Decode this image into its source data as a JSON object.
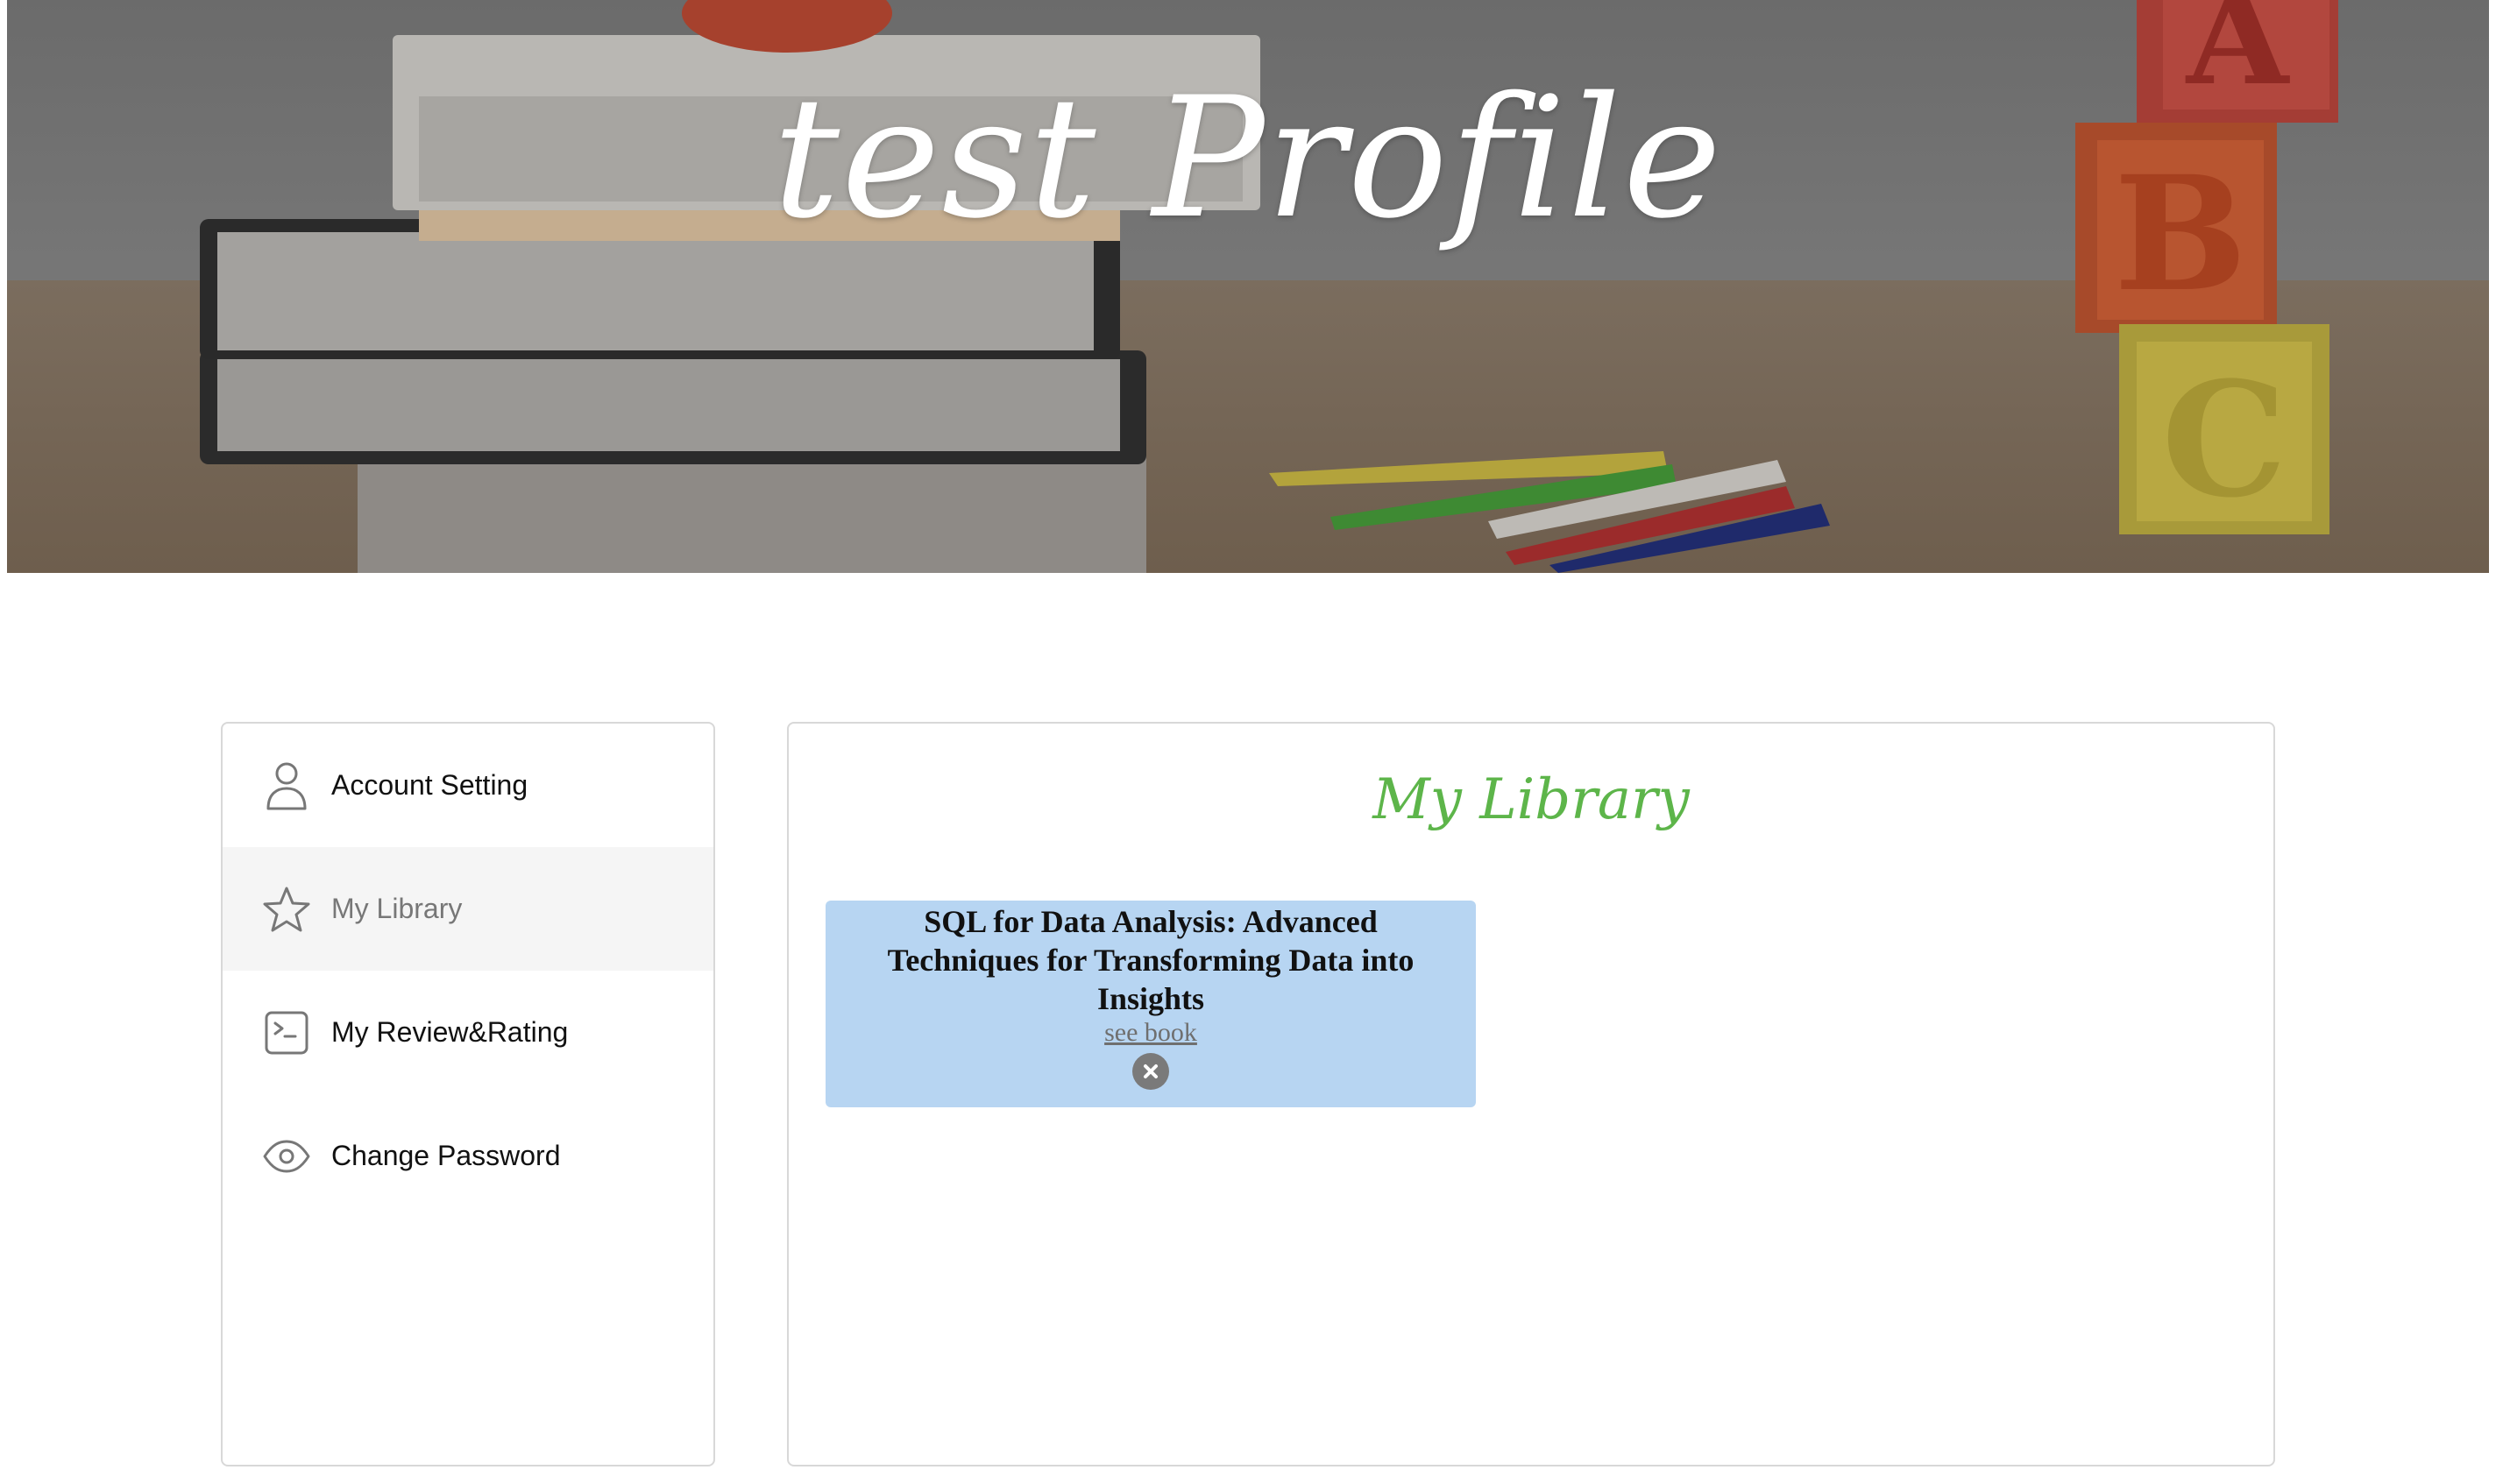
{
  "banner": {
    "title": "test Profile",
    "letters": [
      "A",
      "B",
      "C"
    ]
  },
  "sidebar": {
    "items": [
      {
        "label": "Account Setting",
        "icon": "user-icon",
        "active": false
      },
      {
        "label": "My Library",
        "icon": "star-icon",
        "active": true
      },
      {
        "label": "My Review&Rating",
        "icon": "terminal-icon",
        "active": false
      },
      {
        "label": "Change Password",
        "icon": "eye-icon",
        "active": false
      }
    ]
  },
  "main": {
    "title": "My Library",
    "books": [
      {
        "title": "SQL for Data Analysis: Advanced Techniques for Transforming Data into Insights",
        "link_label": "see book",
        "remove_icon": "close-circle-icon"
      }
    ]
  },
  "colors": {
    "title_green": "#5db54a",
    "card_blue": "#b7d5f2",
    "active_bg": "#f5f5f5"
  }
}
